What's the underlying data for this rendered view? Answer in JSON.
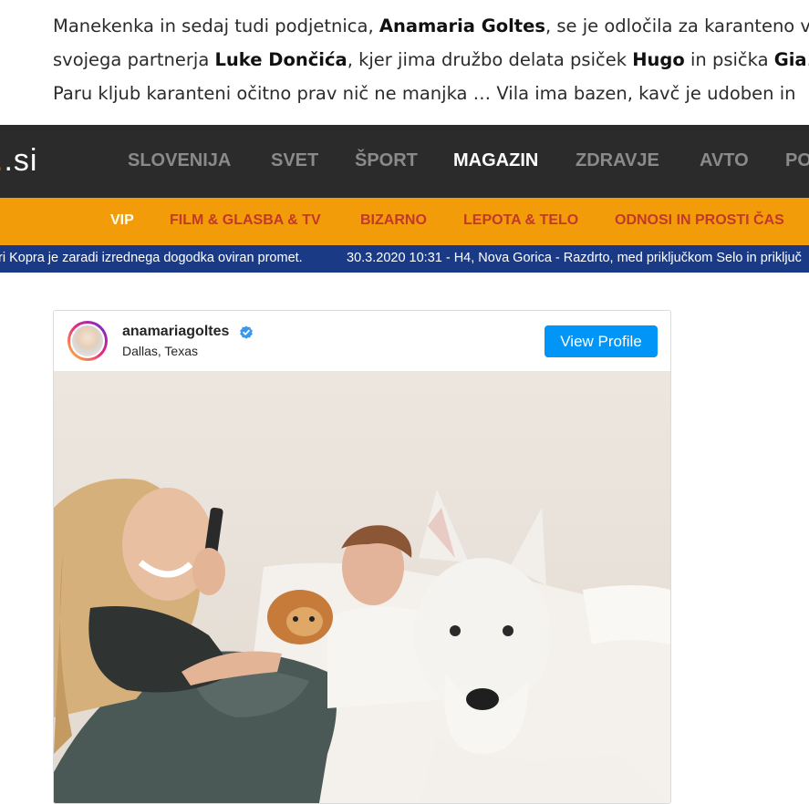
{
  "article": {
    "line1_a": "Manekenka in sedaj tudi podjetnica, ",
    "line1_b": "Anamaria Goltes",
    "line1_c": ", se je odločila za karanteno v v",
    "line2_a": "svojega partnerja ",
    "line2_b": "Luke Dončića",
    "line2_c": ", kjer jima družbo delata psiček ",
    "line2_d": "Hugo",
    "line2_e": " in psička ",
    "line2_f": "Gia",
    "line2_g": ".",
    "line3": "Paru kljub karanteni očitno prav nič ne manjka … Vila ima bazen, kavč je udoben in"
  },
  "site": {
    "logo_suffix": ".si",
    "nav": [
      "SLOVENIJA",
      "SVET",
      "ŠPORT",
      "MAGAZIN",
      "ZDRAVJE",
      "AVTO",
      "PO"
    ],
    "active_nav": "MAGAZIN",
    "subnav": [
      "VIP",
      "FILM & GLASBA & TV",
      "BIZARNO",
      "LEPOTA & TELO",
      "ODNOSI IN PROSTI ČAS"
    ],
    "active_subnav": "VIP",
    "ticker": [
      "ri Kopra je zaradi izrednega dogodka oviran promet.",
      "30.3.2020 10:31 - H4, Nova Gorica - Razdrto, med priključkom Selo in priključ"
    ]
  },
  "instagram": {
    "username": "anamariagoltes",
    "location": "Dallas, Texas",
    "view_profile": "View Profile",
    "verified_icon": "verified-badge-icon",
    "brand_color": "#0095f6"
  }
}
